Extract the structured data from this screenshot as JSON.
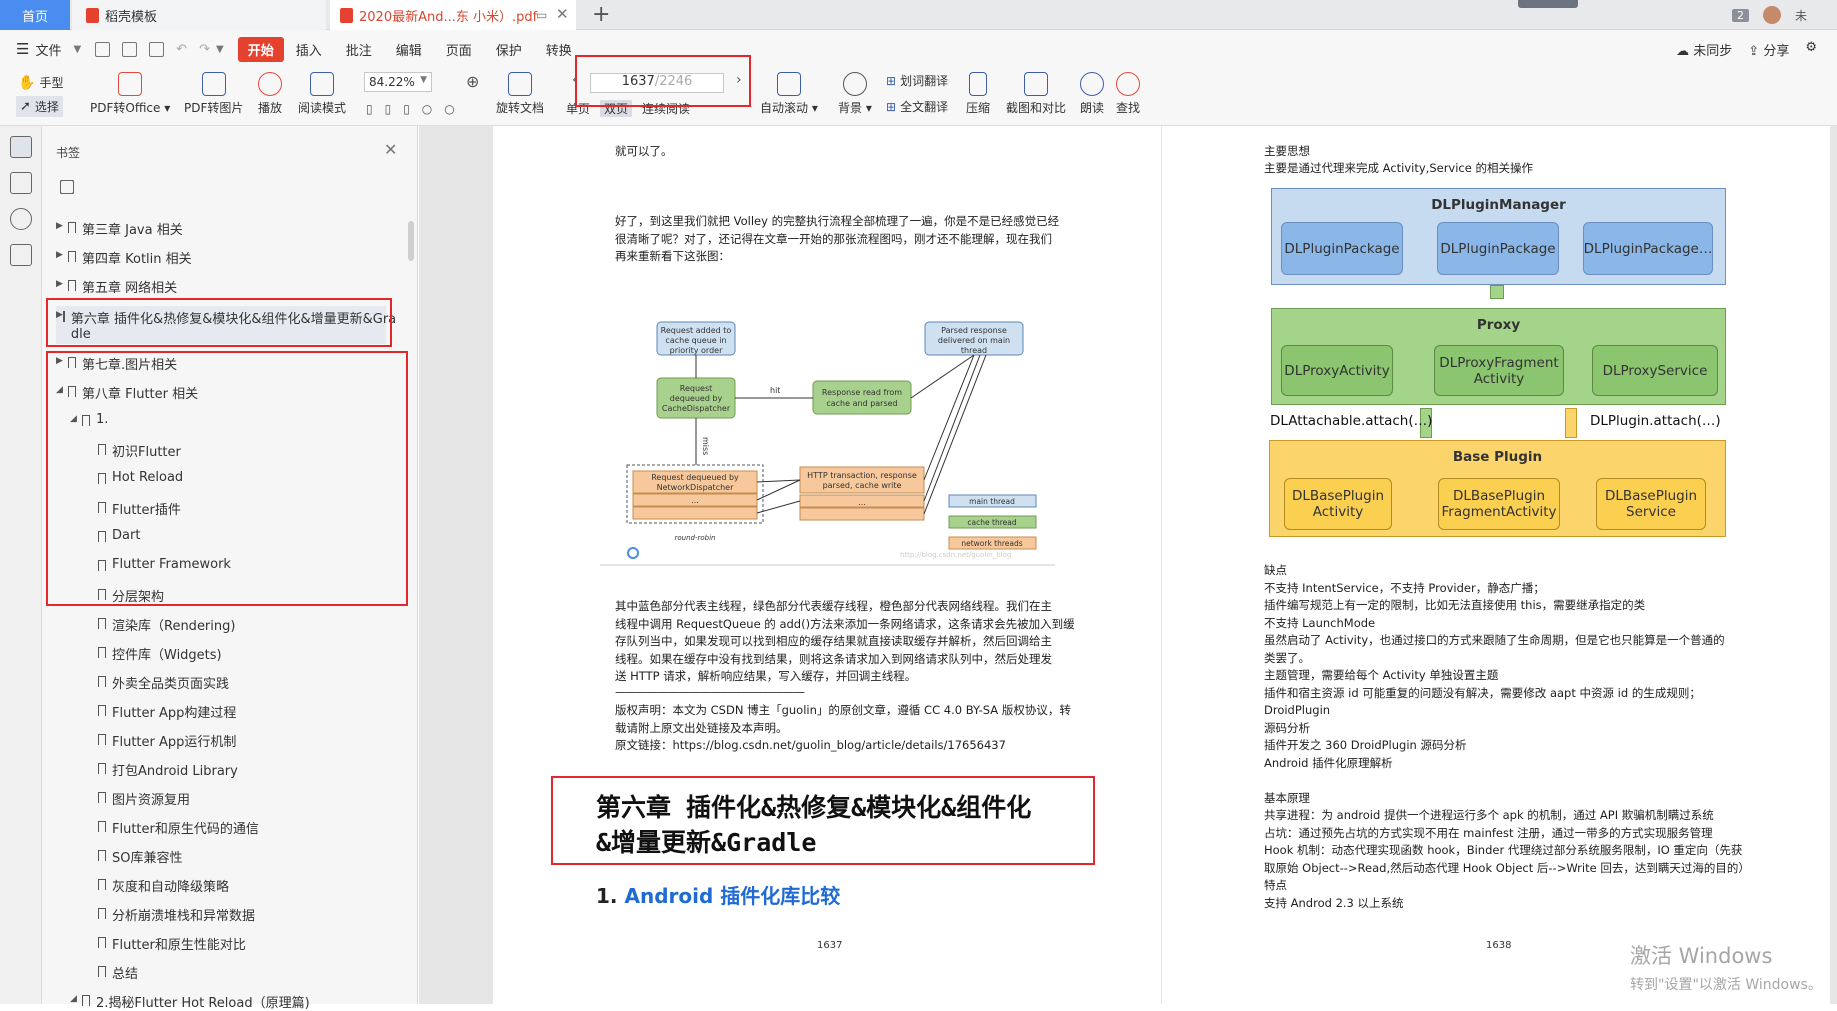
{
  "tabs": {
    "home": "首页",
    "doc": "稻壳模板",
    "pdf": "2020最新And...东 小米）.pdf",
    "badge": "2",
    "user": "未"
  },
  "menu": {
    "file": "文件",
    "start": "开始",
    "items": [
      "插入",
      "批注",
      "编辑",
      "页面",
      "保护",
      "转换"
    ],
    "sync": "未同步",
    "share": "分享"
  },
  "toolbar": {
    "hand": "手型",
    "select": "选择",
    "pdf_office": "PDF转Office",
    "pdf_image": "PDF转图片",
    "play": "播放",
    "read_mode": "阅读模式",
    "zoom": "84.22%",
    "rotate": "旋转文档",
    "single": "单页",
    "double": "双页",
    "continuous": "连续阅读",
    "auto_scroll": "自动滚动",
    "background": "背景",
    "word_translate": "划词翻译",
    "full_translate": "全文翻译",
    "compress": "压缩",
    "screenshot": "截图和对比",
    "read_aloud": "朗读",
    "find": "查找",
    "page_current": "1637",
    "page_total": "/2246"
  },
  "panel": {
    "title": "书签",
    "bookmarks": [
      {
        "label": "第三章 Java 相关",
        "arrow": "▶"
      },
      {
        "label": "第四章 Kotlin 相关",
        "arrow": "▶"
      },
      {
        "label": "第五章 网络相关",
        "arrow": "▶"
      },
      {
        "label": "第六章 插件化&热修复&模块化&组件化&增量更新&Gra",
        "label2": "dle",
        "arrow": "▶"
      },
      {
        "label": "第七章.图片相关",
        "arrow": "▶"
      },
      {
        "label": "第八章 Flutter 相关",
        "arrow": "◢"
      },
      {
        "label": "1.",
        "arrow": "◢"
      },
      {
        "label": "初识Flutter"
      },
      {
        "label": "Hot Reload"
      },
      {
        "label": "Flutter插件"
      },
      {
        "label": "Dart"
      },
      {
        "label": "Flutter Framework"
      },
      {
        "label": "分层架构"
      },
      {
        "label": "渲染库（Rendering)"
      },
      {
        "label": "控件库（Widgets)"
      },
      {
        "label": "外卖全品类页面实践"
      },
      {
        "label": "Flutter App构建过程"
      },
      {
        "label": "Flutter App运行机制"
      },
      {
        "label": "打包Android Library"
      },
      {
        "label": "图片资源复用"
      },
      {
        "label": "Flutter和原生代码的通信"
      },
      {
        "label": "SO库兼容性"
      },
      {
        "label": "灰度和自动降级策略"
      },
      {
        "label": "分析崩溃堆栈和异常数据"
      },
      {
        "label": "Flutter和原生性能对比"
      },
      {
        "label": "总结"
      },
      {
        "label": "2.揭秘Flutter Hot Reload（原理篇)",
        "arrow": "◢"
      }
    ]
  },
  "page1": {
    "l1": "就可以了。",
    "p1": [
      "好了，到这里我们就把 Volley 的完整执行流程全部梳理了一遍，你是不是已经感觉已经",
      "很清晰了呢？对了，还记得在文章一开始的那张流程图吗，刚才还不能理解，现在我们",
      "再来重新看下这张图："
    ],
    "diagram": {
      "b1": "Request added to cache queue in priority order",
      "b2": "Request dequeued by CacheDispatcher",
      "b3": "Response read from cache and parsed",
      "b4": "Parsed response delivered on main thread",
      "b5": "Request dequeued by NetworkDispatcher",
      "b6": "HTTP transaction, response parsed, cache write",
      "hit": "hit",
      "miss": "miss",
      "rr": "round-robin",
      "leg1": "main thread",
      "leg2": "cache thread",
      "leg3": "network threads",
      "dots": "...",
      "url": "http://blog.csdn.net/guolin_blog"
    },
    "p2": [
      "其中蓝色部分代表主线程，绿色部分代表缓存线程，橙色部分代表网络线程。我们在主",
      "线程中调用 RequestQueue 的 add()方法来添加一条网络请求，这条请求会先被加入到缓",
      "存队列当中，如果发现可以找到相应的缓存结果就直接读取缓存并解析，然后回调给主",
      "线程。如果在缓存中没有找到结果，则将这条请求加入到网络请求队列中，然后处理发",
      "送 HTTP 请求，解析响应结果，写入缓存，并回调主线程。"
    ],
    "rule": "——————————————————",
    "p3": [
      "版权声明：本文为 CSDN 博主「guolin」的原创文章，遵循  CC 4.0 BY-SA 版权协议，转",
      "载请附上原文出处链接及本声明。",
      "原文链接：https://blog.csdn.net/guolin_blog/article/details/17656437"
    ],
    "chapter": [
      "第六章 插件化&热修复&模块化&组件化",
      "&增量更新&Gradle"
    ],
    "sec_num": "1.",
    "sec_title": "Android 插件化库比较",
    "num": "1637"
  },
  "page2": {
    "t1": "主要思想",
    "t2": "主要是通过代理来完成 Activity,Service 的相关操作",
    "diag": {
      "mgr": "DLPluginManager",
      "pk1": "DLPluginPackage",
      "pk2": "DLPluginPackage",
      "pk3": "DLPluginPackage…",
      "proxy": "Proxy",
      "pa": "DLProxyActivity",
      "pf1": "DLProxyFragment",
      "pf2": "Activity",
      "ps": "DLProxyService",
      "att": "DLAttachable.attach(…)",
      "plg": "DLPlugin.attach(…)",
      "base": "Base Plugin",
      "b1a": "DLBasePlugin",
      "b1b": "Activity",
      "b2a": "DLBasePlugin",
      "b2b": "FragmentActivity",
      "b3a": "DLBasePlugin",
      "b3b": "Service"
    },
    "lines": [
      "缺点",
      "不支持 IntentService，不支持  Provider，静态广播；",
      "插件编写规范上有一定的限制，比如无法直接使用 this，需要继承指定的类",
      "不支持 LaunchMode",
      "虽然启动了 Activity，也通过接口的方式来跟随了生命周期，但是它也只能算是一个普通的",
      "类罢了。",
      "主题管理，需要给每个 Activity 单独设置主题",
      "插件和宿主资源  id 可能重复的问题没有解决，需要修改  aapt 中资源  id 的生成规则；",
      "DroidPlugin",
      "源码分析",
      "插件开发之 360 DroidPlugin 源码分析",
      "Android 插件化原理解析",
      "",
      "基本原理",
      "共享进程：为 android 提供一个进程运行多个 apk 的机制，通过 API 欺骗机制瞒过系统",
      "占坑：通过预先占坑的方式实现不用在 mainfest 注册，通过一带多的方式实现服务管理",
      "Hook 机制：动态代理实现函数 hook，Binder 代理绕过部分系统服务限制，IO 重定向（先获",
      "取原始 Object-->Read,然后动态代理 Hook Object 后-->Write 回去，达到瞒天过海的目的）",
      "特点",
      "支持 Androd 2.3 以上系统"
    ],
    "num": "1638"
  },
  "watermark": {
    "w1": "激活 Windows",
    "w2": "转到\"设置\"以激活 Windows。"
  },
  "colors": {
    "accent": "#4a8cf0",
    "start": "#e5412f",
    "highlight": "#e3272a",
    "blue_box": "#a9c8ec",
    "green_box": "#a3d48a",
    "yellow_box": "#fbd46b"
  }
}
